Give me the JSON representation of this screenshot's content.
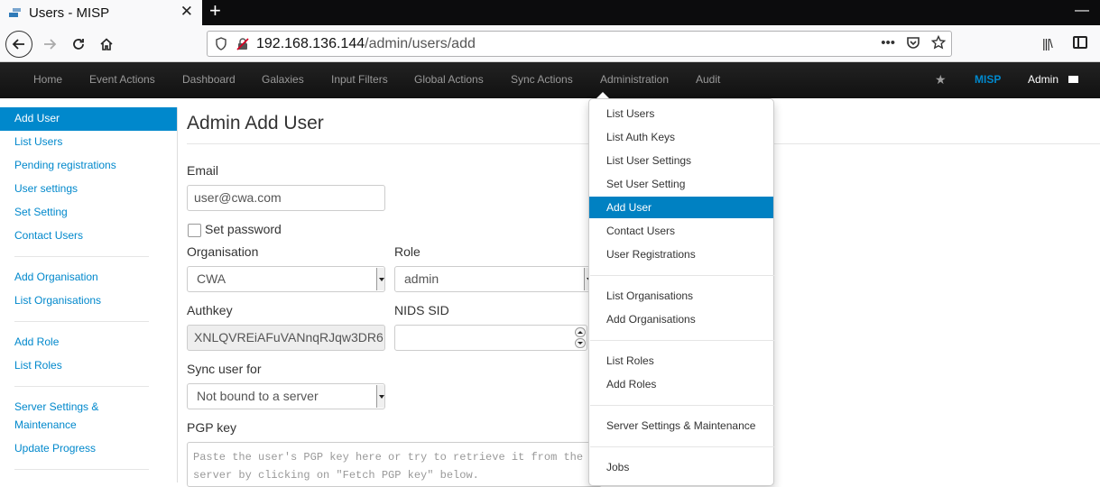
{
  "browser": {
    "tab_title": "Users - MISP",
    "tab_close": "✕",
    "new_tab": "+",
    "url_host": "192.168.136.144",
    "url_path": "/admin/users/add"
  },
  "topnav": {
    "items": [
      "Home",
      "Event Actions",
      "Dashboard",
      "Galaxies",
      "Input Filters",
      "Global Actions",
      "Sync Actions",
      "Administration",
      "Audit"
    ],
    "brand": "MISP",
    "user": "Admin"
  },
  "sidebar": {
    "items": [
      "Add User",
      "List Users",
      "Pending registrations",
      "User settings",
      "Set Setting",
      "Contact Users",
      "Add Organisation",
      "List Organisations",
      "Add Role",
      "List Roles",
      "Server Settings &",
      "Maintenance",
      "Update Progress"
    ],
    "active": "Add User"
  },
  "form": {
    "title": "Admin Add User",
    "email_label": "Email",
    "email_value": "user@cwa.com",
    "set_password_label": "Set password",
    "organisation_label": "Organisation",
    "organisation_value": "CWA",
    "role_label": "Role",
    "role_value": "admin",
    "authkey_label": "Authkey",
    "authkey_value": "XNLQVREiAFuVANnqRJqw3DR6",
    "nids_label": "NIDS SID",
    "nids_value": "",
    "sync_label": "Sync user for",
    "sync_value": "Not bound to a server",
    "pgp_label": "PGP key",
    "pgp_placeholder_line1": "Paste the user's PGP key here or try to retrieve it from the",
    "pgp_placeholder_line2": "server by clicking on \"Fetch PGP key\" below."
  },
  "admin_menu": {
    "items": [
      "List Users",
      "List Auth Keys",
      "List User Settings",
      "Set User Setting",
      "Add User",
      "Contact Users",
      "User Registrations",
      "List Organisations",
      "Add Organisations",
      "List Roles",
      "Add Roles",
      "Server Settings & Maintenance",
      "Jobs"
    ],
    "active": "Add User"
  },
  "colors": {
    "accent": "#0088cc",
    "nav_bg": "#1b1b1b"
  }
}
